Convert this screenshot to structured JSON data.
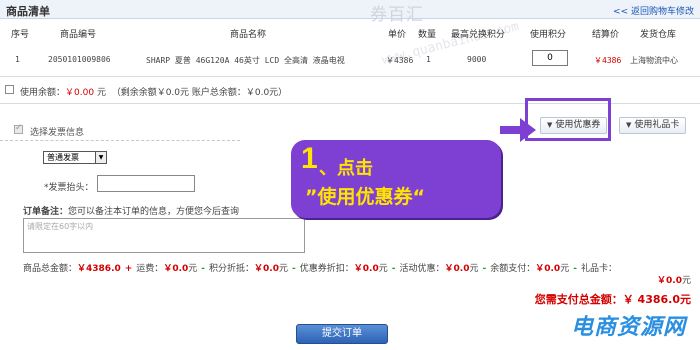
{
  "header": {
    "title": "商品清单",
    "back_link": "<< 返回购物车修改"
  },
  "watermark": {
    "top": "券百汇",
    "diagonal": "www.quanbaihui.com",
    "bottom": "电商资源网"
  },
  "table": {
    "headers": [
      "序号",
      "商品编号",
      "商品名称",
      "单价",
      "数量",
      "最高兑换积分",
      "使用积分",
      "结算价",
      "发货仓库"
    ],
    "rows": [
      {
        "index": "1",
        "sku": "2050101009806",
        "name": "SHARP 夏普 46G120A 46英寸 LCD 全高清 液晶电视",
        "price": "￥4386",
        "qty": "1",
        "max_points": "9000",
        "use_points": "0",
        "settle_price": "￥4386",
        "warehouse": "上海物流中心"
      }
    ]
  },
  "balance": {
    "label": "使用余额：",
    "amount": "￥0.00",
    "unit": "元",
    "remain": "（剩余余额￥0.0元  账户总余额：￥0.0元）"
  },
  "buttons": {
    "coupon": "使用优惠券",
    "giftcard": "使用礼品卡",
    "submit": "提交订单"
  },
  "invoice": {
    "checkbox_label": "选择发票信息",
    "type_selected": "普通发票",
    "title_label": "*发票抬头："
  },
  "note": {
    "label_bold": "订单备注：",
    "label_text": "您可以备注本订单的信息，方便您今后查询",
    "placeholder": "请限定在60字以内"
  },
  "totals": {
    "goods_label": "商品总金额：",
    "goods_value": "￥4386.0",
    "shipping_label": "运费：",
    "shipping_value": "￥0.0",
    "points_label": "积分折抵：",
    "points_value": "￥0.0",
    "coupon_label": "优惠券折扣：",
    "coupon_value": "￥0.0",
    "promo_label": "活动优惠：",
    "promo_value": "￥0.0",
    "balance_label": "余额支付：",
    "balance_value": "￥0.0",
    "giftcard_label": "礼品卡：",
    "giftcard_value": "￥0.0",
    "unit": "元",
    "grand_label": "您需支付总金额：",
    "grand_value": "￥ 4386.0",
    "grand_unit": "元"
  },
  "callout": {
    "step": "1",
    "line1": "、点击",
    "line2": "”使用优惠券“"
  },
  "colors": {
    "accent_red": "#d40000",
    "callout_purple": "#7e3fd3",
    "callout_text": "#ffe400"
  }
}
